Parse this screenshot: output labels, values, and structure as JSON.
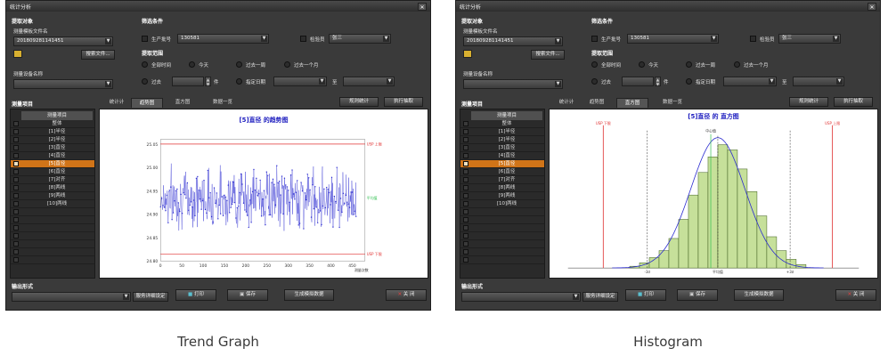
{
  "windows": [
    {
      "title": "统计分析",
      "close_glyph": "✕",
      "sections": {
        "target": "提取对象",
        "filter": "筛选条件",
        "range": "提取范围",
        "items": "测量项目",
        "output": "输出形式"
      },
      "template_label": "测量模板文件名",
      "template_value": "20180928114145​1",
      "search_file_button": "搜索文件...",
      "device_label": "测量设备名称",
      "device_value": "",
      "production_no_label": "生产批号",
      "production_no_value": "130581",
      "inspector_label": "检验员",
      "inspector_value": "张三",
      "range_options": [
        "全部时间",
        "今天",
        "过去一周",
        "过去一个月"
      ],
      "past_label": "过去",
      "past_unit": "件",
      "date_label": "指定日期",
      "date_to": "至",
      "rule_button": "规则统计",
      "execute_button": "执行抽取",
      "tabs": [
        "统计计",
        "趋势图",
        "直方图",
        "数据一览"
      ],
      "active_tab": 1,
      "list_header": "测量项目",
      "list_items": [
        "整体",
        "[1]半径",
        "[2]半径",
        "[3]直径",
        "[4]直径",
        "[5]直径",
        "[6]直径",
        "[7]对齐",
        "[8]两线",
        "[9]两线",
        "[10]两线"
      ],
      "selected_index": 5,
      "output_value": "",
      "dist_button": "服务详细设定",
      "print_button": "打印",
      "save_button": "保存",
      "generate_button": "生成模拟数据",
      "close_button": "关 闭",
      "chart_title": "[5]直径 的趋势图"
    },
    {
      "title": "统计分析",
      "close_glyph": "✕",
      "sections": {
        "target": "提取对象",
        "filter": "筛选条件",
        "range": "提取范围",
        "items": "测量项目",
        "output": "输出形式"
      },
      "template_label": "测量模板文件名",
      "template_value": "20180928114145​1",
      "search_file_button": "搜索文件...",
      "device_label": "测量设备名称",
      "device_value": "",
      "production_no_label": "生产批号",
      "production_no_value": "130581",
      "inspector_label": "检验员",
      "inspector_value": "张三",
      "range_options": [
        "全部时间",
        "今天",
        "过去一周",
        "过去一个月"
      ],
      "past_label": "过去",
      "past_unit": "件",
      "date_label": "指定日期",
      "date_to": "至",
      "rule_button": "规则统计",
      "execute_button": "执行抽取",
      "tabs": [
        "统计计",
        "趋势图",
        "直方图",
        "数据一览"
      ],
      "active_tab": 2,
      "list_header": "测量项目",
      "list_items": [
        "整体",
        "[1]半径",
        "[2]半径",
        "[3]直径",
        "[4]直径",
        "[5]直径",
        "[6]直径",
        "[7]对齐",
        "[8]两线",
        "[9]两线",
        "[10]两线"
      ],
      "selected_index": 5,
      "output_value": "",
      "dist_button": "服务详细设定",
      "print_button": "打印",
      "save_button": "保存",
      "generate_button": "生成模拟数据",
      "close_button": "关 闭",
      "chart_title": "[5]直径 的 直方图"
    }
  ],
  "captions": [
    "Trend Graph",
    "Histogram"
  ],
  "colors": {
    "selection": "#d07418",
    "series": "#2b2bd0",
    "limit": "#e03030",
    "bars": "#c6e09a",
    "bar_edge": "#3a5a1a",
    "mean_line": "#30c050"
  },
  "chart_data": [
    {
      "type": "line",
      "title": "[5]直径 的趋势图",
      "x_ticks": [
        0,
        50,
        100,
        150,
        200,
        250,
        300,
        350,
        400,
        450
      ],
      "x_label": "测量次数",
      "y_ticks": [
        24.8,
        24.85,
        24.9,
        24.95,
        25.0,
        25.05
      ],
      "ylim": [
        24.8,
        25.06
      ],
      "xlim": [
        0,
        480
      ],
      "usl": 25.05,
      "lsl": 24.815,
      "usl_label": "USP 上限",
      "lsl_label": "USP 下限",
      "mean_label": "平均值",
      "n_points": 460,
      "mean": 24.935,
      "spread": 0.045,
      "seed": 7
    },
    {
      "type": "bar",
      "title": "[5]直径 的 直方图",
      "values": [
        1,
        3,
        6,
        10,
        17,
        28,
        42,
        55,
        64,
        71,
        68,
        57,
        44,
        30,
        18,
        10,
        5,
        2
      ],
      "usl_label": "USP 上限",
      "lsl_label": "USP 下限",
      "mean_label": "平均值",
      "median_label": "中心值",
      "sigma_minus_label": "-3σ",
      "sigma_plus_label": "+3σ"
    }
  ]
}
